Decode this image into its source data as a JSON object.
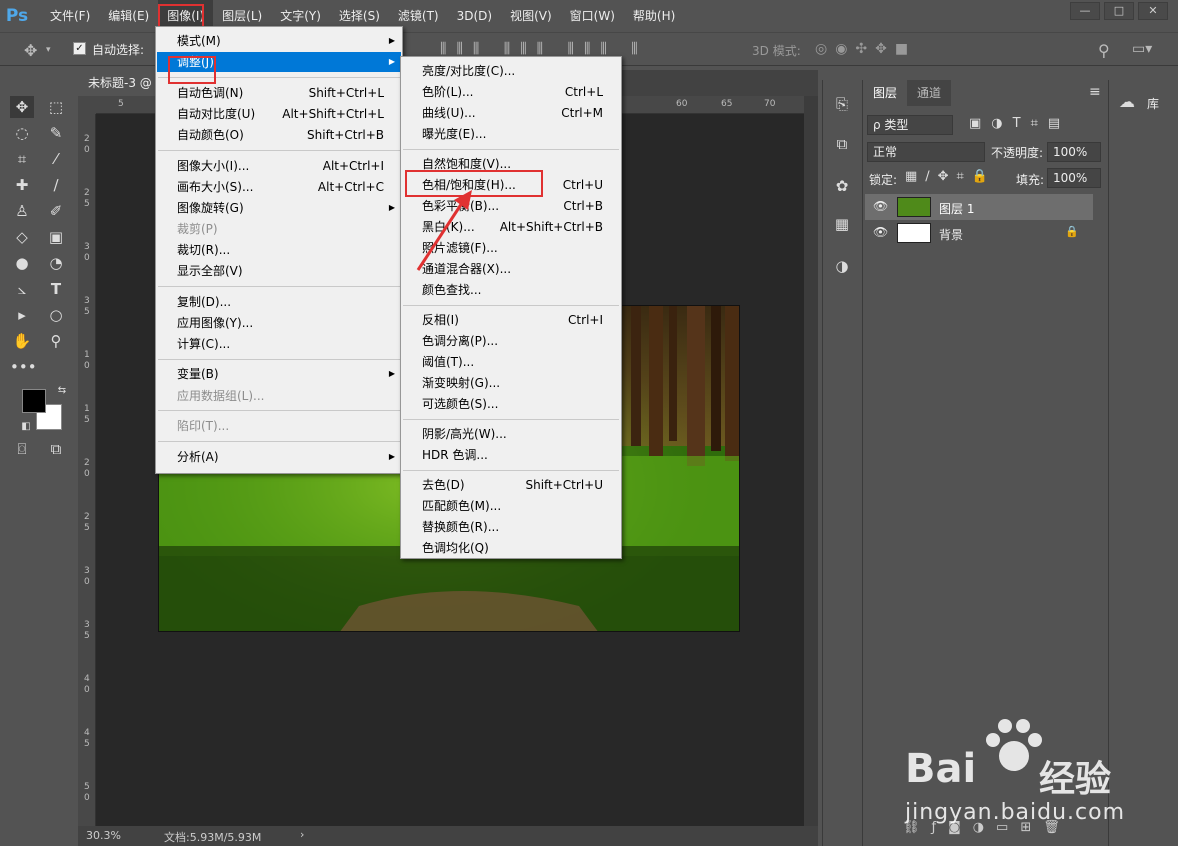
{
  "app": {
    "logo": "Ps"
  },
  "menubar": [
    "文件(F)",
    "编辑(E)",
    "图像(I)",
    "图层(L)",
    "文字(Y)",
    "选择(S)",
    "滤镜(T)",
    "3D(D)",
    "视图(V)",
    "窗口(W)",
    "帮助(H)"
  ],
  "window_controls": [
    "—",
    "□",
    "✕"
  ],
  "options": {
    "auto_select": "自动选择:",
    "mode3d": "3D 模式:"
  },
  "document": {
    "tab_title": "未标题-3 @",
    "zoom": "30.3%",
    "doc_size": "文档:5.93M/5.93M",
    "status_arrow": "›"
  },
  "rulers": {
    "top": [
      "5",
      "60",
      "65",
      "70"
    ],
    "left": [
      "2",
      "0",
      "2",
      "5",
      "3",
      "0",
      "3",
      "5",
      "1",
      "0",
      "1",
      "5",
      "2",
      "0",
      "2",
      "5",
      "3",
      "0",
      "3",
      "5",
      "4",
      "0",
      "4",
      "5",
      "5",
      "0"
    ]
  },
  "image_menu": {
    "items": [
      {
        "label": "模式(M)",
        "submenu": true
      },
      {
        "label": "调整(J)",
        "submenu": true,
        "highlighted": true
      },
      {
        "label": "自动色调(N)",
        "shortcut": "Shift+Ctrl+L"
      },
      {
        "label": "自动对比度(U)",
        "shortcut": "Alt+Shift+Ctrl+L"
      },
      {
        "label": "自动颜色(O)",
        "shortcut": "Shift+Ctrl+B"
      },
      {
        "label": "图像大小(I)...",
        "shortcut": "Alt+Ctrl+I"
      },
      {
        "label": "画布大小(S)...",
        "shortcut": "Alt+Ctrl+C"
      },
      {
        "label": "图像旋转(G)",
        "submenu": true
      },
      {
        "label": "裁剪(P)",
        "disabled": true
      },
      {
        "label": "裁切(R)..."
      },
      {
        "label": "显示全部(V)"
      },
      {
        "label": "复制(D)..."
      },
      {
        "label": "应用图像(Y)..."
      },
      {
        "label": "计算(C)..."
      },
      {
        "label": "变量(B)",
        "submenu": true
      },
      {
        "label": "应用数据组(L)...",
        "disabled": true
      },
      {
        "label": "陷印(T)...",
        "disabled": true
      },
      {
        "label": "分析(A)",
        "submenu": true
      }
    ]
  },
  "adjust_menu": {
    "items": [
      {
        "label": "亮度/对比度(C)..."
      },
      {
        "label": "色阶(L)...",
        "shortcut": "Ctrl+L"
      },
      {
        "label": "曲线(U)...",
        "shortcut": "Ctrl+M"
      },
      {
        "label": "曝光度(E)..."
      },
      {
        "label": "自然饱和度(V)..."
      },
      {
        "label": "色相/饱和度(H)...",
        "shortcut": "Ctrl+U"
      },
      {
        "label": "色彩平衡(B)...",
        "shortcut": "Ctrl+B"
      },
      {
        "label": "黑白(K)...",
        "shortcut": "Alt+Shift+Ctrl+B"
      },
      {
        "label": "照片滤镜(F)..."
      },
      {
        "label": "通道混合器(X)..."
      },
      {
        "label": "颜色查找..."
      },
      {
        "label": "反相(I)",
        "shortcut": "Ctrl+I"
      },
      {
        "label": "色调分离(P)..."
      },
      {
        "label": "阈值(T)..."
      },
      {
        "label": "渐变映射(G)..."
      },
      {
        "label": "可选颜色(S)..."
      },
      {
        "label": "阴影/高光(W)..."
      },
      {
        "label": "HDR 色调..."
      },
      {
        "label": "去色(D)",
        "shortcut": "Shift+Ctrl+U"
      },
      {
        "label": "匹配颜色(M)..."
      },
      {
        "label": "替换颜色(R)..."
      },
      {
        "label": "色调均化(Q)"
      }
    ]
  },
  "layers_panel": {
    "tabs": [
      "图层",
      "通道"
    ],
    "filter_kind": "ρ 类型",
    "blend_mode": "正常",
    "opacity_label": "不透明度:",
    "opacity_value": "100%",
    "lock_label": "锁定:",
    "fill_label": "填充:",
    "fill_value": "100%",
    "layers": [
      {
        "name": "图层 1",
        "selected": true
      },
      {
        "name": "背景",
        "locked": true
      }
    ]
  },
  "libraries": {
    "label": "库"
  },
  "watermark": {
    "brand": "Bai",
    "brand_cn": "经验",
    "url": "jingyan.baidu.com"
  },
  "colors": {
    "accent_blue": "#0078d7",
    "annotation_red": "#e03131",
    "ps_blue": "#4fa8ea"
  }
}
